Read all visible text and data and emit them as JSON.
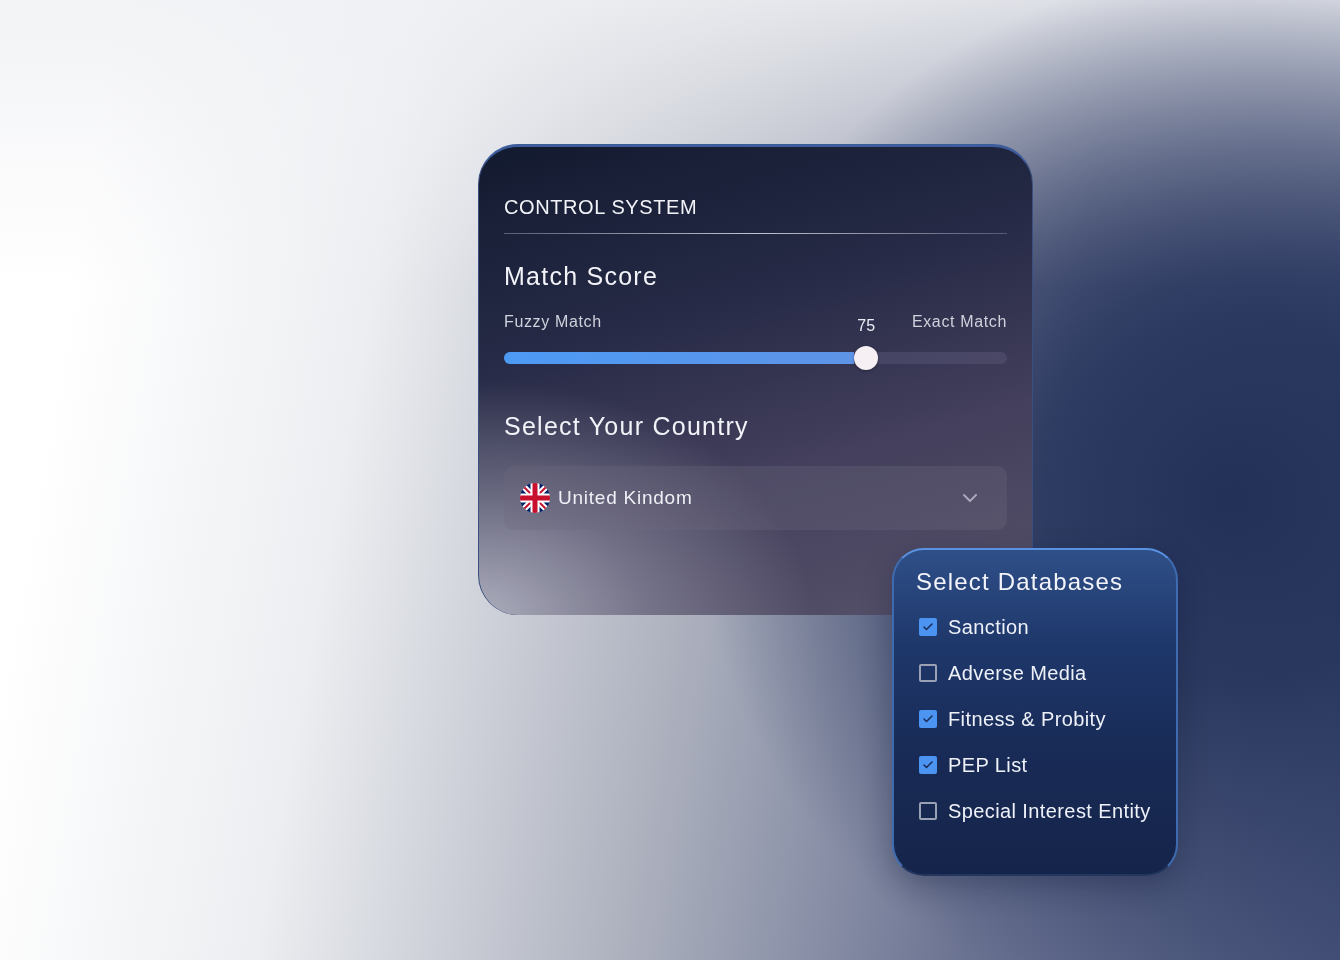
{
  "control_panel": {
    "title": "CONTROL SYSTEM",
    "match_score": {
      "heading": "Match Score",
      "min_label": "Fuzzy Match",
      "max_label": "Exact Match",
      "reading": "75",
      "level": 0.72
    },
    "country": {
      "heading": "Select Your Country",
      "value": "United Kindom"
    }
  },
  "databases": {
    "title": "Select Databases",
    "items": [
      {
        "label": "Sanction",
        "checked": true
      },
      {
        "label": "Adverse Media",
        "checked": false
      },
      {
        "label": "Fitness & Probity",
        "checked": true
      },
      {
        "label": "PEP List",
        "checked": true
      },
      {
        "label": "Special Interest Entity",
        "checked": false
      }
    ]
  }
}
